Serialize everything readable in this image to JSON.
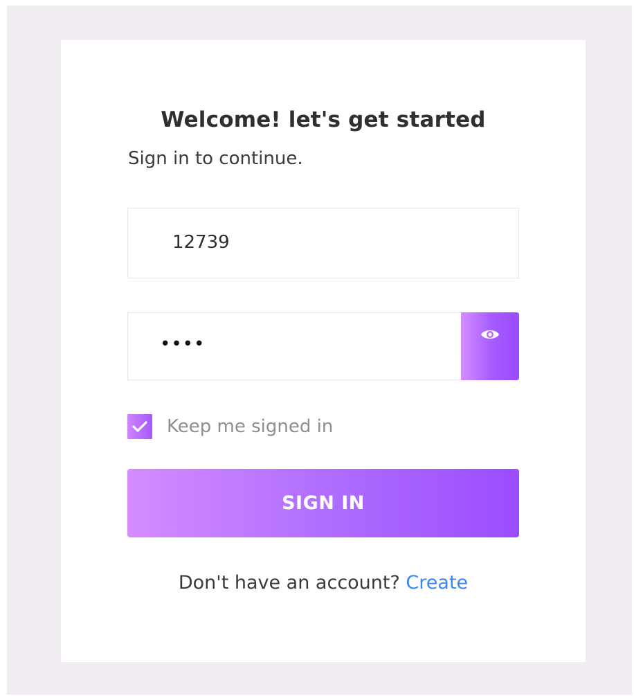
{
  "header": {
    "title": "Welcome! let's get started",
    "subtitle": "Sign in to continue."
  },
  "form": {
    "username_value": "12739",
    "password_masked": "••••",
    "show_password_icon": "eye-icon",
    "remember_checked": true,
    "remember_label": "Keep me signed in",
    "submit_label": "SIGN IN"
  },
  "footer": {
    "prompt": "Don't have an account?",
    "link_label": "Create"
  },
  "colors": {
    "background": "#f0ecf2",
    "card": "#ffffff",
    "gradient_start": "#d58cff",
    "gradient_end": "#9a4dff",
    "link": "#3c86f0"
  }
}
